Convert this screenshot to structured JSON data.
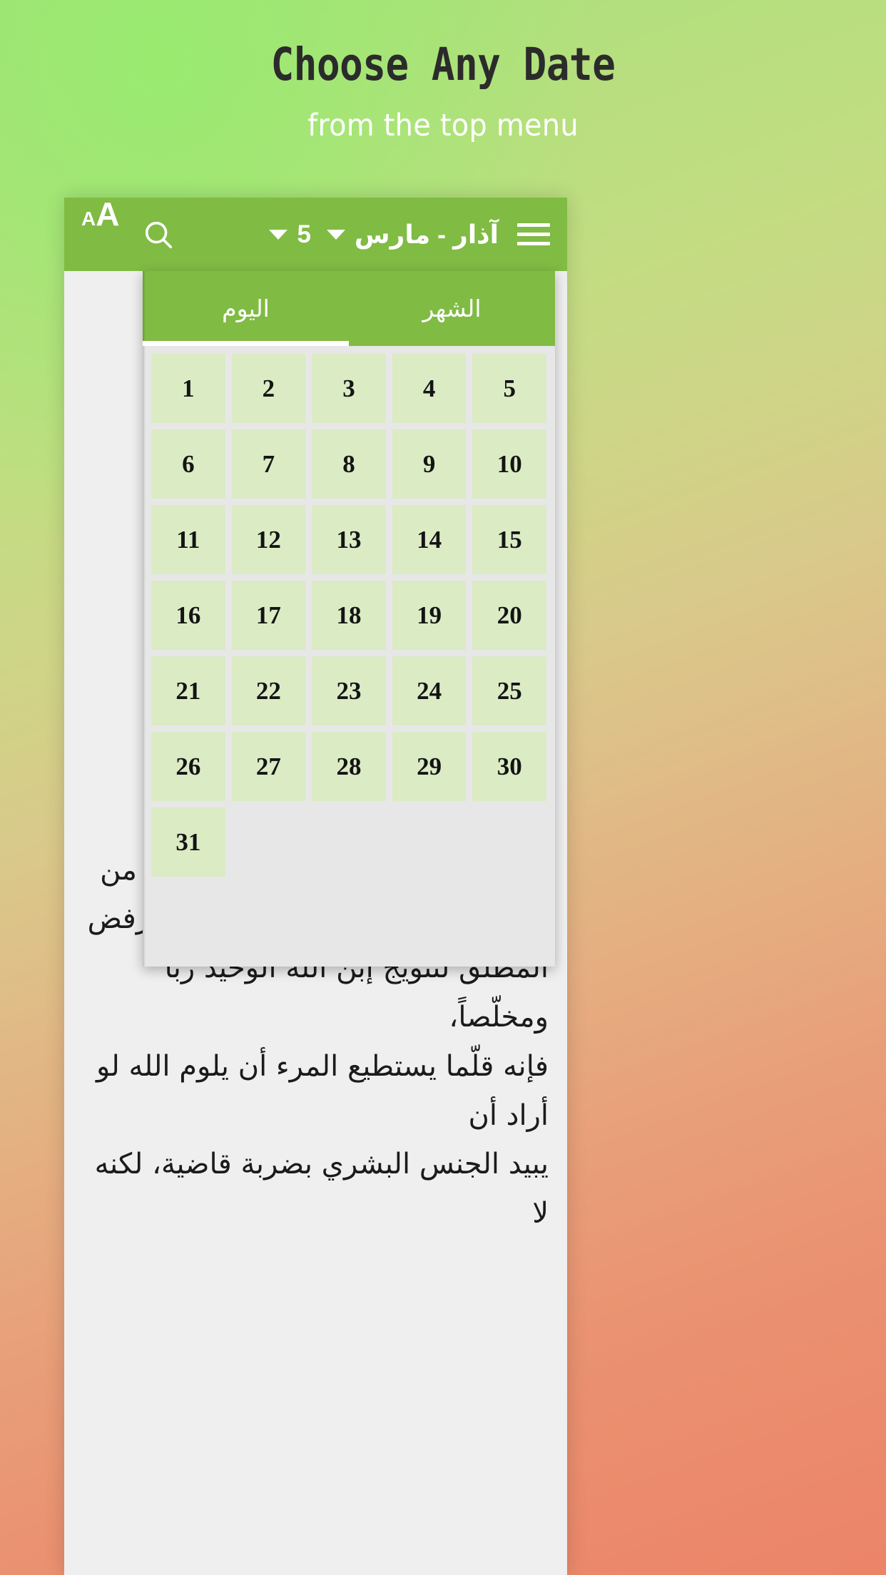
{
  "headline": {
    "title": "Choose Any Date",
    "subtitle": "from the top menu"
  },
  "colors": {
    "toolbar_green": "#80bb43",
    "day_cell_green": "#dbebc4",
    "panel_gray": "#e7e7e7",
    "page_gray": "#efefef",
    "title_dark": "#2b2b2b",
    "bg_gradient_start": "#a6e07a",
    "bg_gradient_end": "#ec8468"
  },
  "toolbar": {
    "font_size_icon": "Aa",
    "font_size_icon_small": "A",
    "font_size_icon_big": "A",
    "search_icon": "search-icon",
    "month_label": "آذار - مارس",
    "day_label": "5",
    "menu_icon": "hamburger-menu-icon"
  },
  "dropdown": {
    "tabs": [
      {
        "label": "الشهر",
        "name": "tab-month",
        "active": false
      },
      {
        "label": "اليوم",
        "name": "tab-day",
        "active": true
      }
    ],
    "days": [
      "5",
      "4",
      "3",
      "2",
      "1",
      "10",
      "9",
      "8",
      "7",
      "6",
      "15",
      "14",
      "13",
      "12",
      "11",
      "20",
      "19",
      "18",
      "17",
      "16",
      "25",
      "24",
      "23",
      "22",
      "21",
      "30",
      "29",
      "28",
      "27",
      "26",
      "",
      "",
      "",
      "",
      "31"
    ],
    "columns": 5,
    "rows": 7
  },
  "page": {
    "arabic_text": "صبر\nحياة\nر مع\n\nخامة\n\n،\nوإنهيار الزواج والبيت، ورفض جملة من\nالمعايير الأخلاقية، وطبعاً، خطيئة الرفض\nالمطلق لتتويج إبن الله الوحيد رباً ومخلّصاً،\nفإنه قلّما يستطيع المرء أن يلوم الله لو أراد أن\nيبيد الجنس البشري بضربة قاضية، لكنه لا"
  }
}
